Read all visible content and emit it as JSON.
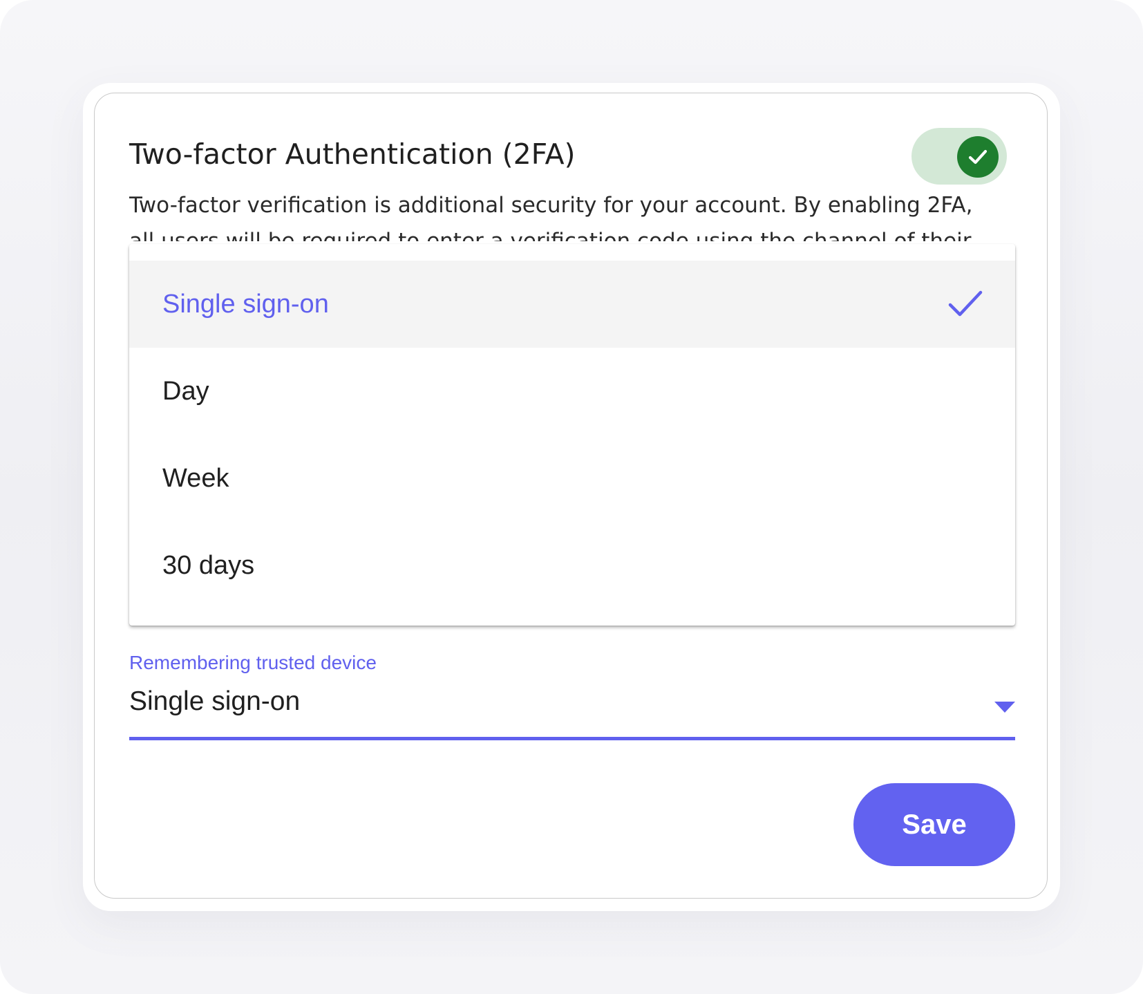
{
  "header": {
    "title": "Two-factor Authentication (2FA)",
    "description": "Two-factor verification is additional security for your account. By enabling 2FA, all users will be required to enter a verification code using the channel of their"
  },
  "twofa_toggle": {
    "state": "on",
    "icon": "check-icon",
    "track_color": "#d3e8d6",
    "knob_color": "#1e7e2e"
  },
  "dropdown": {
    "options": [
      {
        "label": "Single sign-on",
        "selected": true
      },
      {
        "label": "Day",
        "selected": false
      },
      {
        "label": "Week",
        "selected": false
      },
      {
        "label": "30 days",
        "selected": false
      }
    ]
  },
  "trusted_device": {
    "label": "Remembering trusted device",
    "value": "Single sign-on",
    "icon": "caret-down-icon"
  },
  "actions": {
    "save_label": "Save"
  },
  "colors": {
    "accent": "#6262f0",
    "success": "#1e7e2e",
    "text": "#1f1f1f"
  }
}
